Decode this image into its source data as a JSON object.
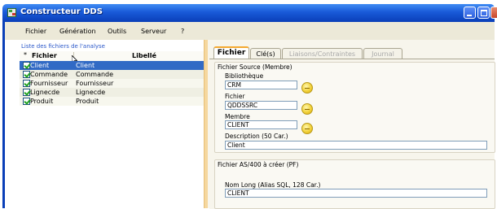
{
  "window": {
    "title": "Constructeur DDS"
  },
  "menu": [
    "Fichier",
    "Génération",
    "Outils",
    "Serveur",
    "?"
  ],
  "left_panel": {
    "title": "Liste des fichiers de l'analyse",
    "columns": {
      "selector": "*",
      "fichier": "Fichier",
      "libelle": "Libellé"
    },
    "rows": [
      {
        "fichier": "Client",
        "libelle": "Client",
        "checked": true,
        "selected": true
      },
      {
        "fichier": "Commande",
        "libelle": "Commande",
        "checked": true,
        "selected": false
      },
      {
        "fichier": "Fournisseur",
        "libelle": "Fournisseur",
        "checked": true,
        "selected": false
      },
      {
        "fichier": "Lignecde",
        "libelle": "Lignecde",
        "checked": true,
        "selected": false
      },
      {
        "fichier": "Produit",
        "libelle": "Produit",
        "checked": true,
        "selected": false
      }
    ]
  },
  "tabs": [
    {
      "label": "Fichier",
      "active": true,
      "enabled": true
    },
    {
      "label": "Clé(s)",
      "active": false,
      "enabled": true
    },
    {
      "label": "Liaisons/Contraintes",
      "active": false,
      "enabled": false
    },
    {
      "label": "Journal",
      "active": false,
      "enabled": false
    }
  ],
  "source_group": {
    "title": "Fichier Source (Membre)",
    "bibliotheque": {
      "label": "Bibliothèque",
      "value": "CRM"
    },
    "fichier": {
      "label": "Fichier",
      "value": "QDDSSRC"
    },
    "membre": {
      "label": "Membre",
      "value": "CLIENT"
    },
    "description": {
      "label": "Description (50 Car.)",
      "value": "Client"
    }
  },
  "as400_group": {
    "title": "Fichier AS/400 à créer (PF)",
    "nom_long": {
      "label": "Nom Long (Alias SQL, 128 Car.)",
      "value": "CLIENT"
    }
  },
  "colors": {
    "titlebar": "#1959d8",
    "selection": "#316ac5",
    "splitter": "#f5d79e",
    "active_tab_accent": "#f4a830"
  }
}
